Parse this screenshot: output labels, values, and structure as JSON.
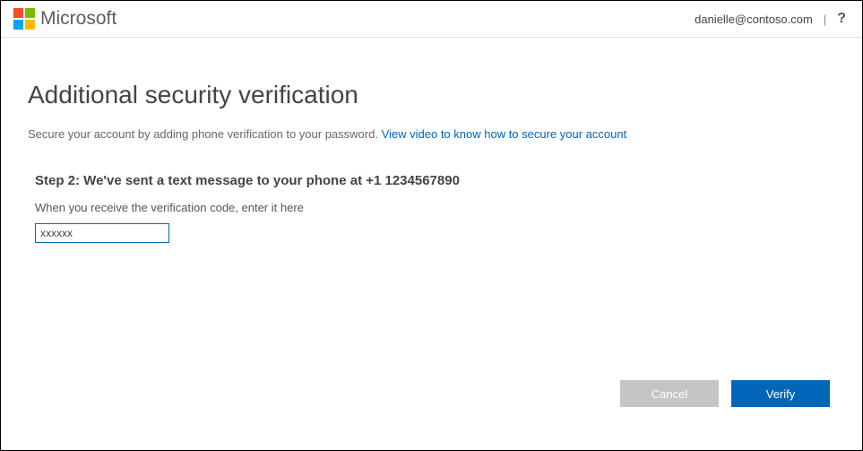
{
  "header": {
    "brand": "Microsoft",
    "user_email": "danielle@contoso.com",
    "help_label": "?"
  },
  "page": {
    "title": "Additional security verification",
    "subtitle_text": "Secure your account by adding phone verification to your password. ",
    "subtitle_link": "View video to know how to secure your account"
  },
  "step": {
    "heading": "Step 2: We've sent a text message to your phone at +1 1234567890",
    "instruction": "When you receive the verification code, enter it here",
    "input_value": "xxxxxx"
  },
  "buttons": {
    "cancel": "Cancel",
    "verify": "Verify"
  }
}
